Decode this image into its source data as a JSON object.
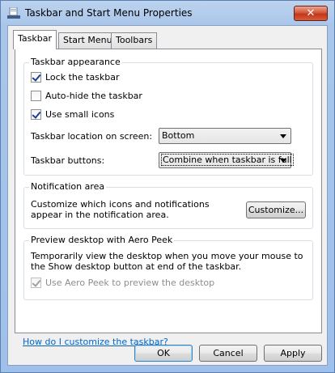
{
  "window": {
    "title": "Taskbar and Start Menu Properties",
    "close_glyph": "✕"
  },
  "tabs": [
    {
      "label": "Taskbar",
      "active": true
    },
    {
      "label": "Start Menu",
      "active": false
    },
    {
      "label": "Toolbars",
      "active": false
    }
  ],
  "appearance": {
    "title": "Taskbar appearance",
    "lock": {
      "label": "Lock the taskbar",
      "checked": true
    },
    "autohide": {
      "label": "Auto-hide the taskbar",
      "checked": false
    },
    "small_icons": {
      "label": "Use small icons",
      "checked": true
    },
    "location_label": "Taskbar location on screen:",
    "location_value": "Bottom",
    "buttons_label": "Taskbar buttons:",
    "buttons_value": "Combine when taskbar is full"
  },
  "notification": {
    "title": "Notification area",
    "description": "Customize which icons and notifications appear in the notification area.",
    "customize_button": "Customize..."
  },
  "peek": {
    "title": "Preview desktop with Aero Peek",
    "description": "Temporarily view the desktop when you move your mouse to the Show desktop button at end of the taskbar.",
    "checkbox": {
      "label": "Use Aero Peek to preview the desktop",
      "checked": true,
      "disabled": true
    }
  },
  "help_link": "How do I customize the taskbar?",
  "buttons": {
    "ok": "OK",
    "cancel": "Cancel",
    "apply": "Apply"
  }
}
